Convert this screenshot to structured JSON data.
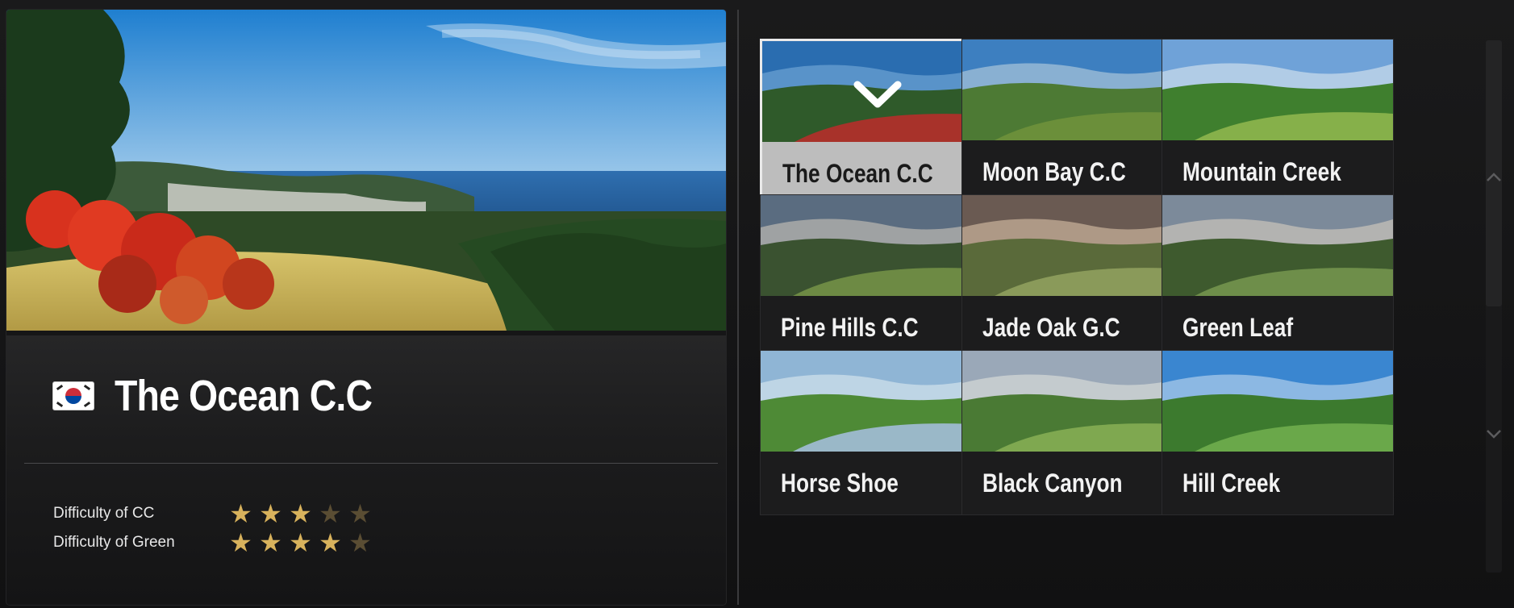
{
  "selected_course": {
    "country_flag": "south-korea-flag-icon",
    "name": "The Ocean C.C",
    "difficulty_cc_label": "Difficulty of CC",
    "difficulty_cc": 3,
    "difficulty_green_label": "Difficulty of Green",
    "difficulty_green": 4,
    "max_stars": 5
  },
  "courses": [
    {
      "name": "The Ocean C.C",
      "selected": true
    },
    {
      "name": "Moon Bay C.C",
      "selected": false
    },
    {
      "name": "Mountain Creek",
      "selected": false
    },
    {
      "name": "Pine Hills C.C",
      "selected": false
    },
    {
      "name": "Jade Oak G.C",
      "selected": false
    },
    {
      "name": "Green Leaf",
      "selected": false
    },
    {
      "name": "Horse Shoe",
      "selected": false
    },
    {
      "name": "Black Canyon",
      "selected": false
    },
    {
      "name": "Hill Creek",
      "selected": false
    }
  ],
  "scroll": {
    "up_icon": "chevron-up-icon",
    "down_icon": "chevron-down-icon"
  },
  "colors": {
    "star_on": "#d8b25c",
    "star_off": "#5a4d33",
    "selected_label_bg": "#bdbdbd"
  }
}
